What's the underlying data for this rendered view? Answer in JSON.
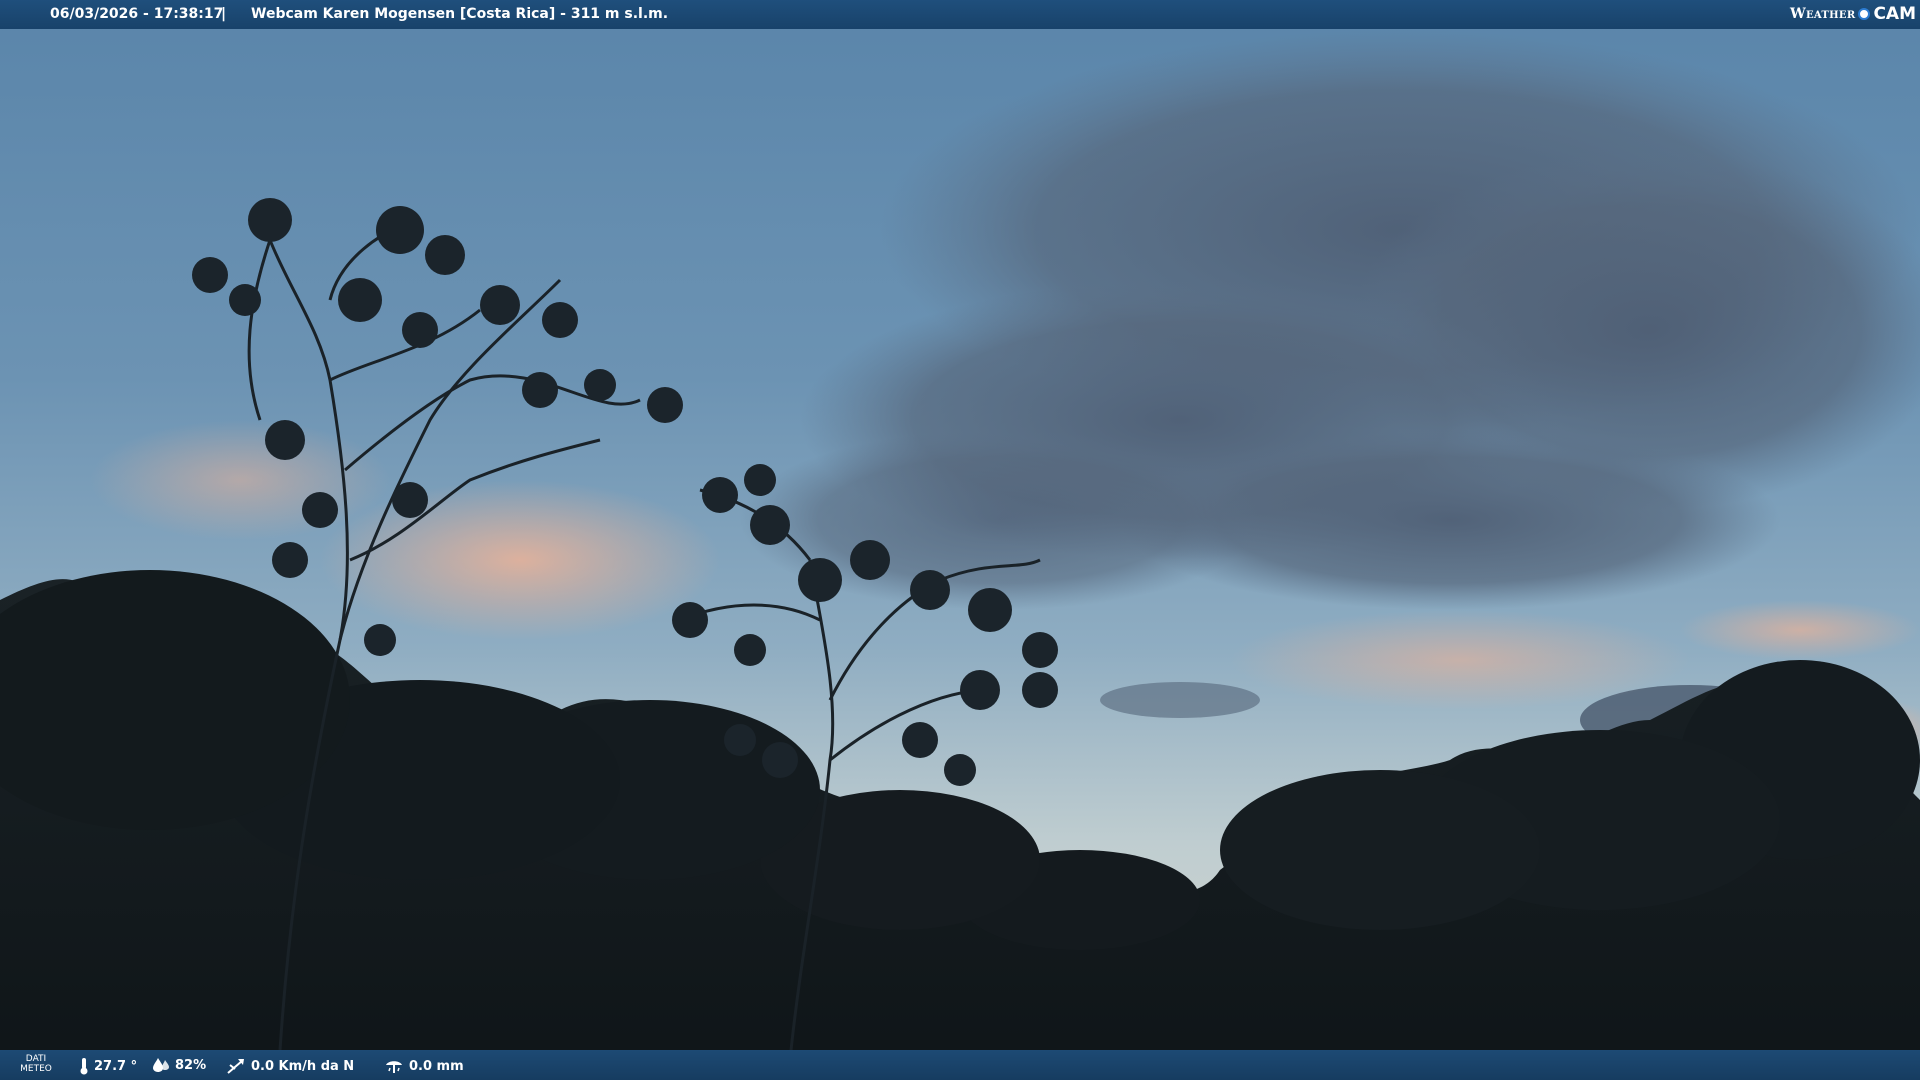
{
  "header": {
    "datetime": "06/03/2026 - 17:38:17",
    "separator": "|",
    "title": "Webcam Karen Mogensen [Costa Rica] - 311 m s.l.m.",
    "logo_left": "Weather",
    "logo_right": "CAM"
  },
  "footer": {
    "dati_line1": "DATI",
    "dati_line2": "METEO",
    "temperature": "27.7 °",
    "humidity": "82%",
    "wind": "0.0 Km/h da N",
    "rain": "0.0 mm"
  },
  "icons": {
    "temperature": "thermometer-icon",
    "humidity": "humidity-drops-icon",
    "wind": "wind-vane-icon",
    "rain": "rain-gauge-icon"
  },
  "colors": {
    "bar": "#1d4a74",
    "sky_top": "#5b86aa",
    "sky_horizon": "#c9d2cf",
    "foliage": "#141b1f"
  }
}
